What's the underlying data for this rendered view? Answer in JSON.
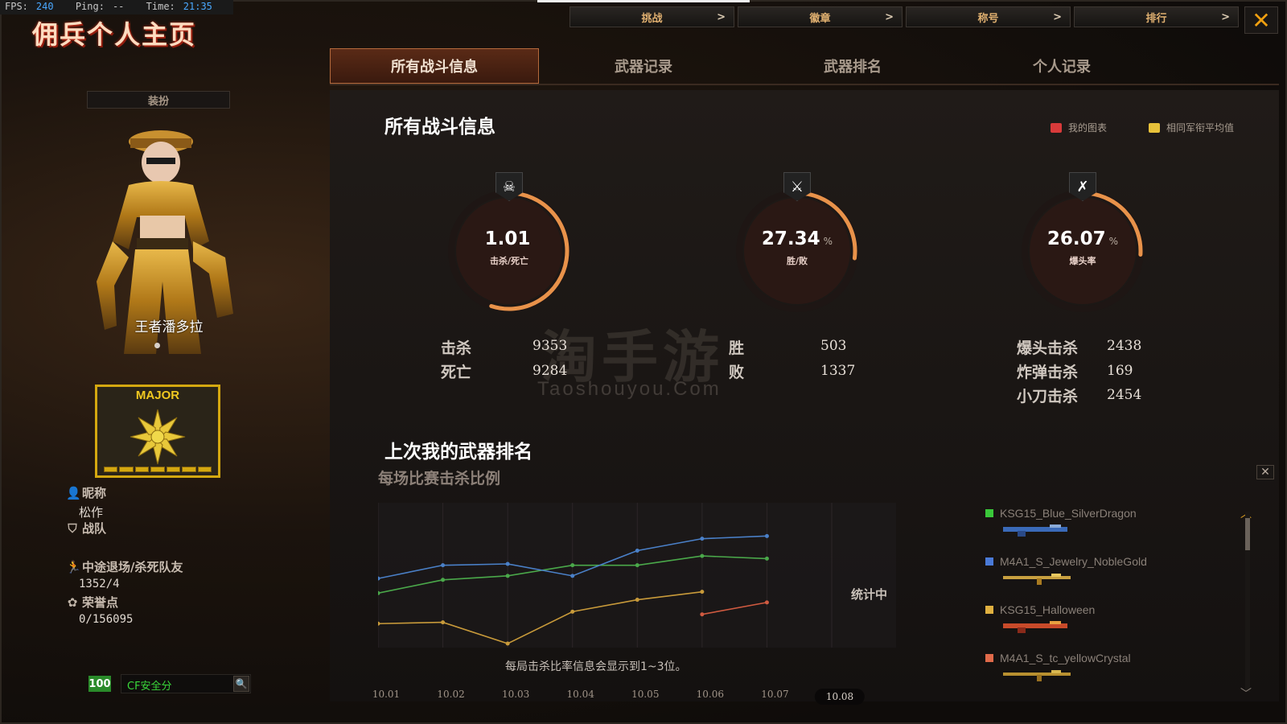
{
  "hud": {
    "fps_label": "FPS:",
    "fps": "240",
    "ping_label": "Ping:",
    "ping": "--",
    "time_label": "Time:",
    "time": "21:35"
  },
  "title": "佣兵个人主页",
  "top_nav": [
    {
      "label": "挑战",
      "arrow": ">"
    },
    {
      "label": "徽章",
      "arrow": ">"
    },
    {
      "label": "称号",
      "arrow": ">"
    },
    {
      "label": "排行",
      "arrow": ">"
    }
  ],
  "close": "✕",
  "tabs": [
    {
      "label": "所有战斗信息",
      "active": true
    },
    {
      "label": "武器记录",
      "active": false
    },
    {
      "label": "武器排名",
      "active": false
    },
    {
      "label": "个人记录",
      "active": false
    }
  ],
  "left": {
    "dress_button": "装扮",
    "character_name": "王者潘多拉",
    "rank_text": "MAJOR",
    "nickname_label": "昵称",
    "nickname": "松作",
    "team_label": "战队",
    "quit_label": "中途退场/杀死队友",
    "quit_value": "1352/4",
    "honor_label": "荣誉点",
    "honor_value": "0/156095",
    "safe_score": "100",
    "safe_label": "CF安全分"
  },
  "panel": {
    "title": "所有战斗信息",
    "legend_mine": "我的图表",
    "legend_avg": "相同军衔平均值",
    "legend_colors": {
      "mine": "#d83a3a",
      "avg": "#e8c23a"
    },
    "gauges": [
      {
        "value": "1.01",
        "unit": "",
        "label": "击杀/死亡",
        "icon": "skull-icon",
        "glyph": "☠",
        "fraction": 0.55
      },
      {
        "value": "27.34",
        "unit": "%",
        "label": "胜/败",
        "icon": "crossed-swords-icon",
        "glyph": "⚔",
        "fraction": 0.27
      },
      {
        "value": "26.07",
        "unit": "%",
        "label": "爆头率",
        "icon": "headshot-icon",
        "glyph": "✗",
        "fraction": 0.26
      }
    ],
    "stats": {
      "kills_label": "击杀",
      "kills": "9353",
      "deaths_label": "死亡",
      "deaths": "9284",
      "wins_label": "胜",
      "wins": "503",
      "losses_label": "败",
      "losses": "1337",
      "headshot_label": "爆头击杀",
      "headshot": "2438",
      "bomb_label": "炸弹击杀",
      "bomb": "169",
      "knife_label": "小刀击杀",
      "knife": "2454"
    },
    "watermark": "淘手游",
    "watermark_sub": "Taoshouyou.Com"
  },
  "weapon_section": {
    "title": "上次我的武器排名",
    "subtitle": "每场比赛击杀比例",
    "note": "每局击杀比率信息会显示到1~3位。",
    "counting": "统计中",
    "weapons": [
      {
        "name": "KSG15_Blue_SilverDragon",
        "color": "#3ac83a"
      },
      {
        "name": "M4A1_S_Jewelry_NobleGold",
        "color": "#4a7ad8"
      },
      {
        "name": "KSG15_Halloween",
        "color": "#e0b040"
      },
      {
        "name": "M4A1_S_tc_yellowCrystal",
        "color": "#e06a4a"
      }
    ]
  },
  "chart_data": {
    "type": "line",
    "categories": [
      "10.01",
      "10.02",
      "10.03",
      "10.04",
      "10.05",
      "10.06",
      "10.07",
      "10.08"
    ],
    "selected": "10.08",
    "ylim": [
      0,
      1
    ],
    "series": [
      {
        "name": "KSG15_Blue_SilverDragon",
        "color": "#4aa84a",
        "values": [
          0.38,
          0.48,
          0.51,
          0.59,
          0.59,
          0.66,
          0.64,
          null
        ]
      },
      {
        "name": "M4A1_S_Jewelry_NobleGold",
        "color": "#4a80c8",
        "values": [
          0.49,
          0.59,
          0.6,
          0.51,
          0.7,
          0.79,
          0.81,
          null
        ]
      },
      {
        "name": "KSG15_Halloween",
        "color": "#c89a3a",
        "values": [
          0.15,
          0.16,
          0.0,
          0.24,
          0.33,
          0.39,
          null,
          null
        ]
      },
      {
        "name": "M4A1_S_tc_yellowCrystal",
        "color": "#d05a40",
        "values": [
          null,
          null,
          null,
          null,
          null,
          0.22,
          0.31,
          null
        ]
      }
    ]
  }
}
